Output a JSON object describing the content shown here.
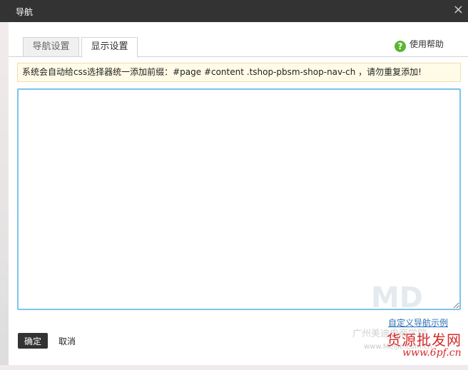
{
  "dialog": {
    "title": "导航",
    "close_label": "×"
  },
  "tabs": [
    {
      "label": "导航设置",
      "active": false
    },
    {
      "label": "显示设置",
      "active": true
    }
  ],
  "help": {
    "icon": "help-circle-icon",
    "label": "使用帮助"
  },
  "notice": "系统会自动给css选择器统一添加前缀：#page #content .tshop-pbsm-shop-nav-ch ，请勿重复添加!",
  "editor": {
    "value": ""
  },
  "example_link": "自定义导航示例",
  "buttons": {
    "ok": "确定",
    "cancel": "取消"
  },
  "watermark": {
    "logo": "MD",
    "line1": "广州美迪电商学院",
    "line2": "货源批发网",
    "url1": "www.Meijie.com.cn",
    "url2": "www.6pf.cn"
  },
  "colors": {
    "titlebar": "#333333",
    "accent_border": "#7ec4e6",
    "help_icon": "#5cb531",
    "notice_bg": "#fffbe6",
    "link": "#2a6fb5"
  }
}
